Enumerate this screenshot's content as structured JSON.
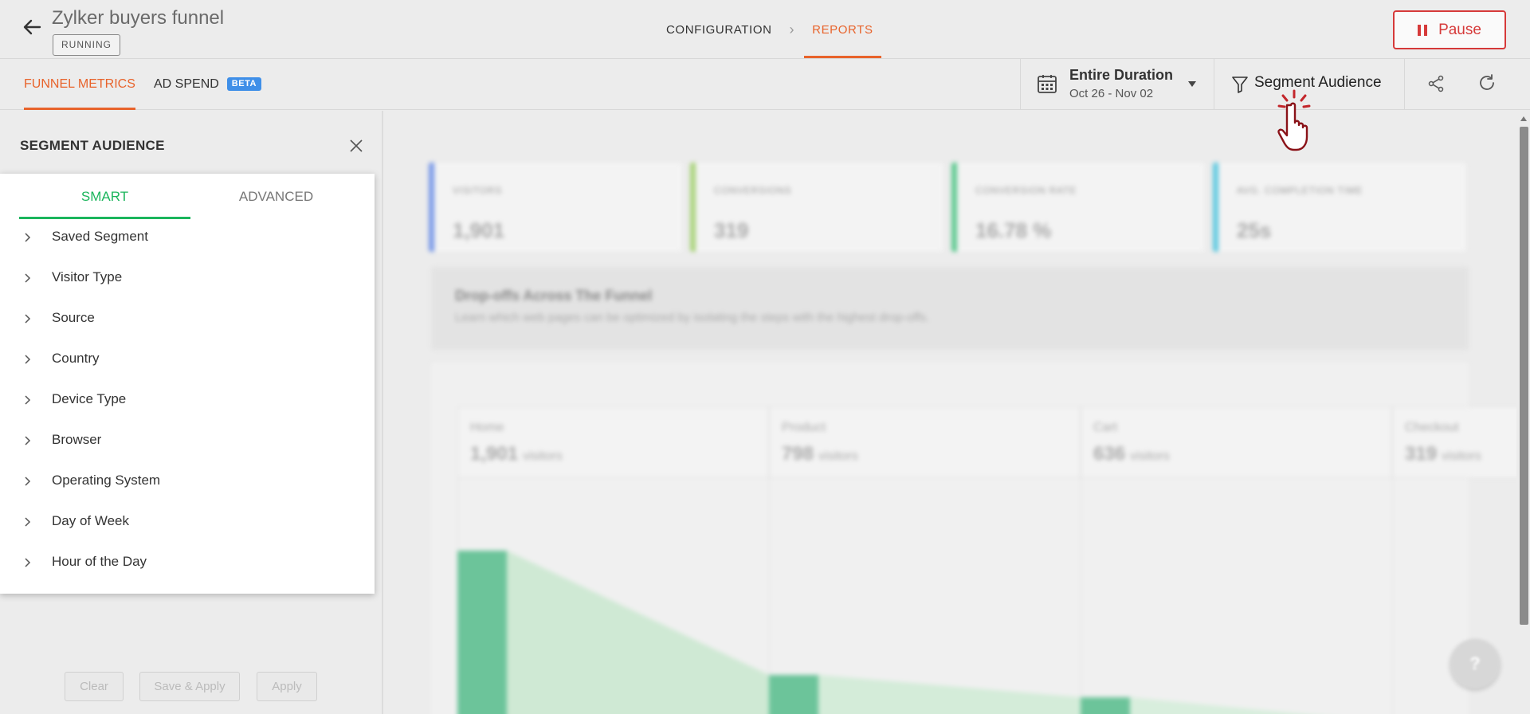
{
  "header": {
    "title": "Zylker buyers funnel",
    "status": "RUNNING",
    "breadcrumbs": [
      "CONFIGURATION",
      "REPORTS"
    ],
    "pause_label": "Pause"
  },
  "tabs": {
    "funnel_metrics": "FUNNEL METRICS",
    "ad_spend": "AD SPEND",
    "beta": "BETA"
  },
  "date_filter": {
    "label": "Entire Duration",
    "range": "Oct 26 - Nov 02"
  },
  "segment_button": {
    "label": "Segment Audience"
  },
  "sidebar": {
    "title": "SEGMENT AUDIENCE",
    "tabs": [
      "SMART",
      "ADVANCED"
    ],
    "options": [
      "Saved Segment",
      "Visitor Type",
      "Source",
      "Country",
      "Device Type",
      "Browser",
      "Operating System",
      "Day of Week",
      "Hour of the Day"
    ],
    "buttons": {
      "clear": "Clear",
      "save_apply": "Save & Apply",
      "apply": "Apply"
    }
  },
  "metrics": [
    {
      "label": "VISITORS",
      "value": "1,901",
      "color": "#7a9ae8"
    },
    {
      "label": "CONVERSIONS",
      "value": "319",
      "color": "#a9d37a"
    },
    {
      "label": "CONVERSION RATE",
      "value": "16.78 %",
      "color": "#5cc98f"
    },
    {
      "label": "AVG. COMPLETION TIME",
      "value": "25s",
      "color": "#5fc9e0"
    }
  ],
  "dropoffs": {
    "title": "Drop-offs Across The Funnel",
    "subtitle": "Learn which web pages can be optimized by isolating the steps with the highest drop-offs."
  },
  "funnel_steps": [
    {
      "name": "Home",
      "value": "1,901",
      "unit": "visitors"
    },
    {
      "name": "Product",
      "value": "798",
      "unit": "visitors"
    },
    {
      "name": "Cart",
      "value": "636",
      "unit": "visitors"
    },
    {
      "name": "Checkout",
      "value": "319",
      "unit": "visitors"
    }
  ],
  "help_label": "?",
  "colors": {
    "accent": "#e8632b",
    "smart_tab": "#1bb55c",
    "pause": "#d63a3a",
    "beta": "#3f8fe8",
    "funnel_bar": "#5cc98f"
  }
}
